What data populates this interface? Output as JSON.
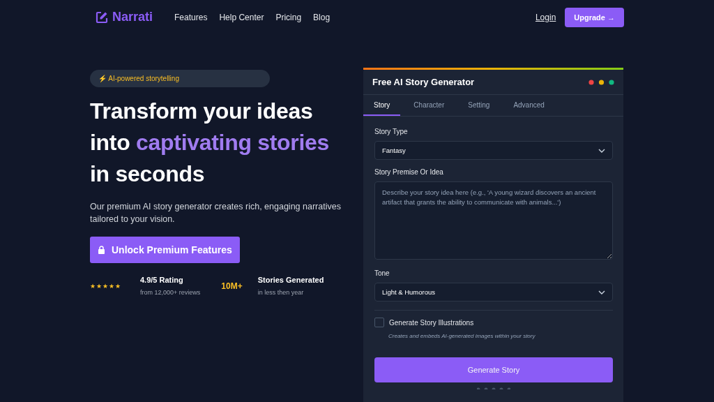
{
  "nav": {
    "logo": "Narrati",
    "links": [
      "Features",
      "Help Center",
      "Pricing",
      "Blog"
    ],
    "login": "Login",
    "upgrade": "Upgrade →"
  },
  "hero": {
    "badge": "⚡ AI-powered storytelling",
    "headline": [
      {
        "text": "Transform your ideas into ",
        "highlight": false
      },
      {
        "text": "captivating stories",
        "highlight": true
      },
      {
        "text": " in seconds",
        "highlight": false
      }
    ],
    "subtitle": "Our premium AI story generator creates rich, engaging narratives tailored to your vision.",
    "cta": "Unlock Premium Features",
    "rating": {
      "stars": 5,
      "title": "4.9/5 Rating",
      "detail": "from 12,000+ reviews"
    },
    "stories": {
      "value": "10M+",
      "title": "Stories Generated",
      "detail": "in less then year"
    }
  },
  "card": {
    "title": "Free AI Story Generator",
    "tabs": [
      {
        "label": "Story",
        "selected": true
      },
      {
        "label": "Character",
        "selected": false
      },
      {
        "label": "Setting",
        "selected": false
      },
      {
        "label": "Advanced",
        "selected": false
      }
    ],
    "story_type": {
      "label": "Story Type",
      "value": "Fantasy"
    },
    "premise": {
      "label": "Story Premise Or Idea",
      "placeholder": "Describe your story idea here (e.g., 'A young wizard discovers an ancient artifact that grants the ability to communicate with animals...')"
    },
    "tone": {
      "label": "Tone",
      "value": "Light & Humorous"
    },
    "illustrations": {
      "label": "Generate Story Illustrations",
      "checked": false,
      "hint": "Creates and embeds AI-generated images within your story"
    },
    "button": "Generate Story"
  }
}
